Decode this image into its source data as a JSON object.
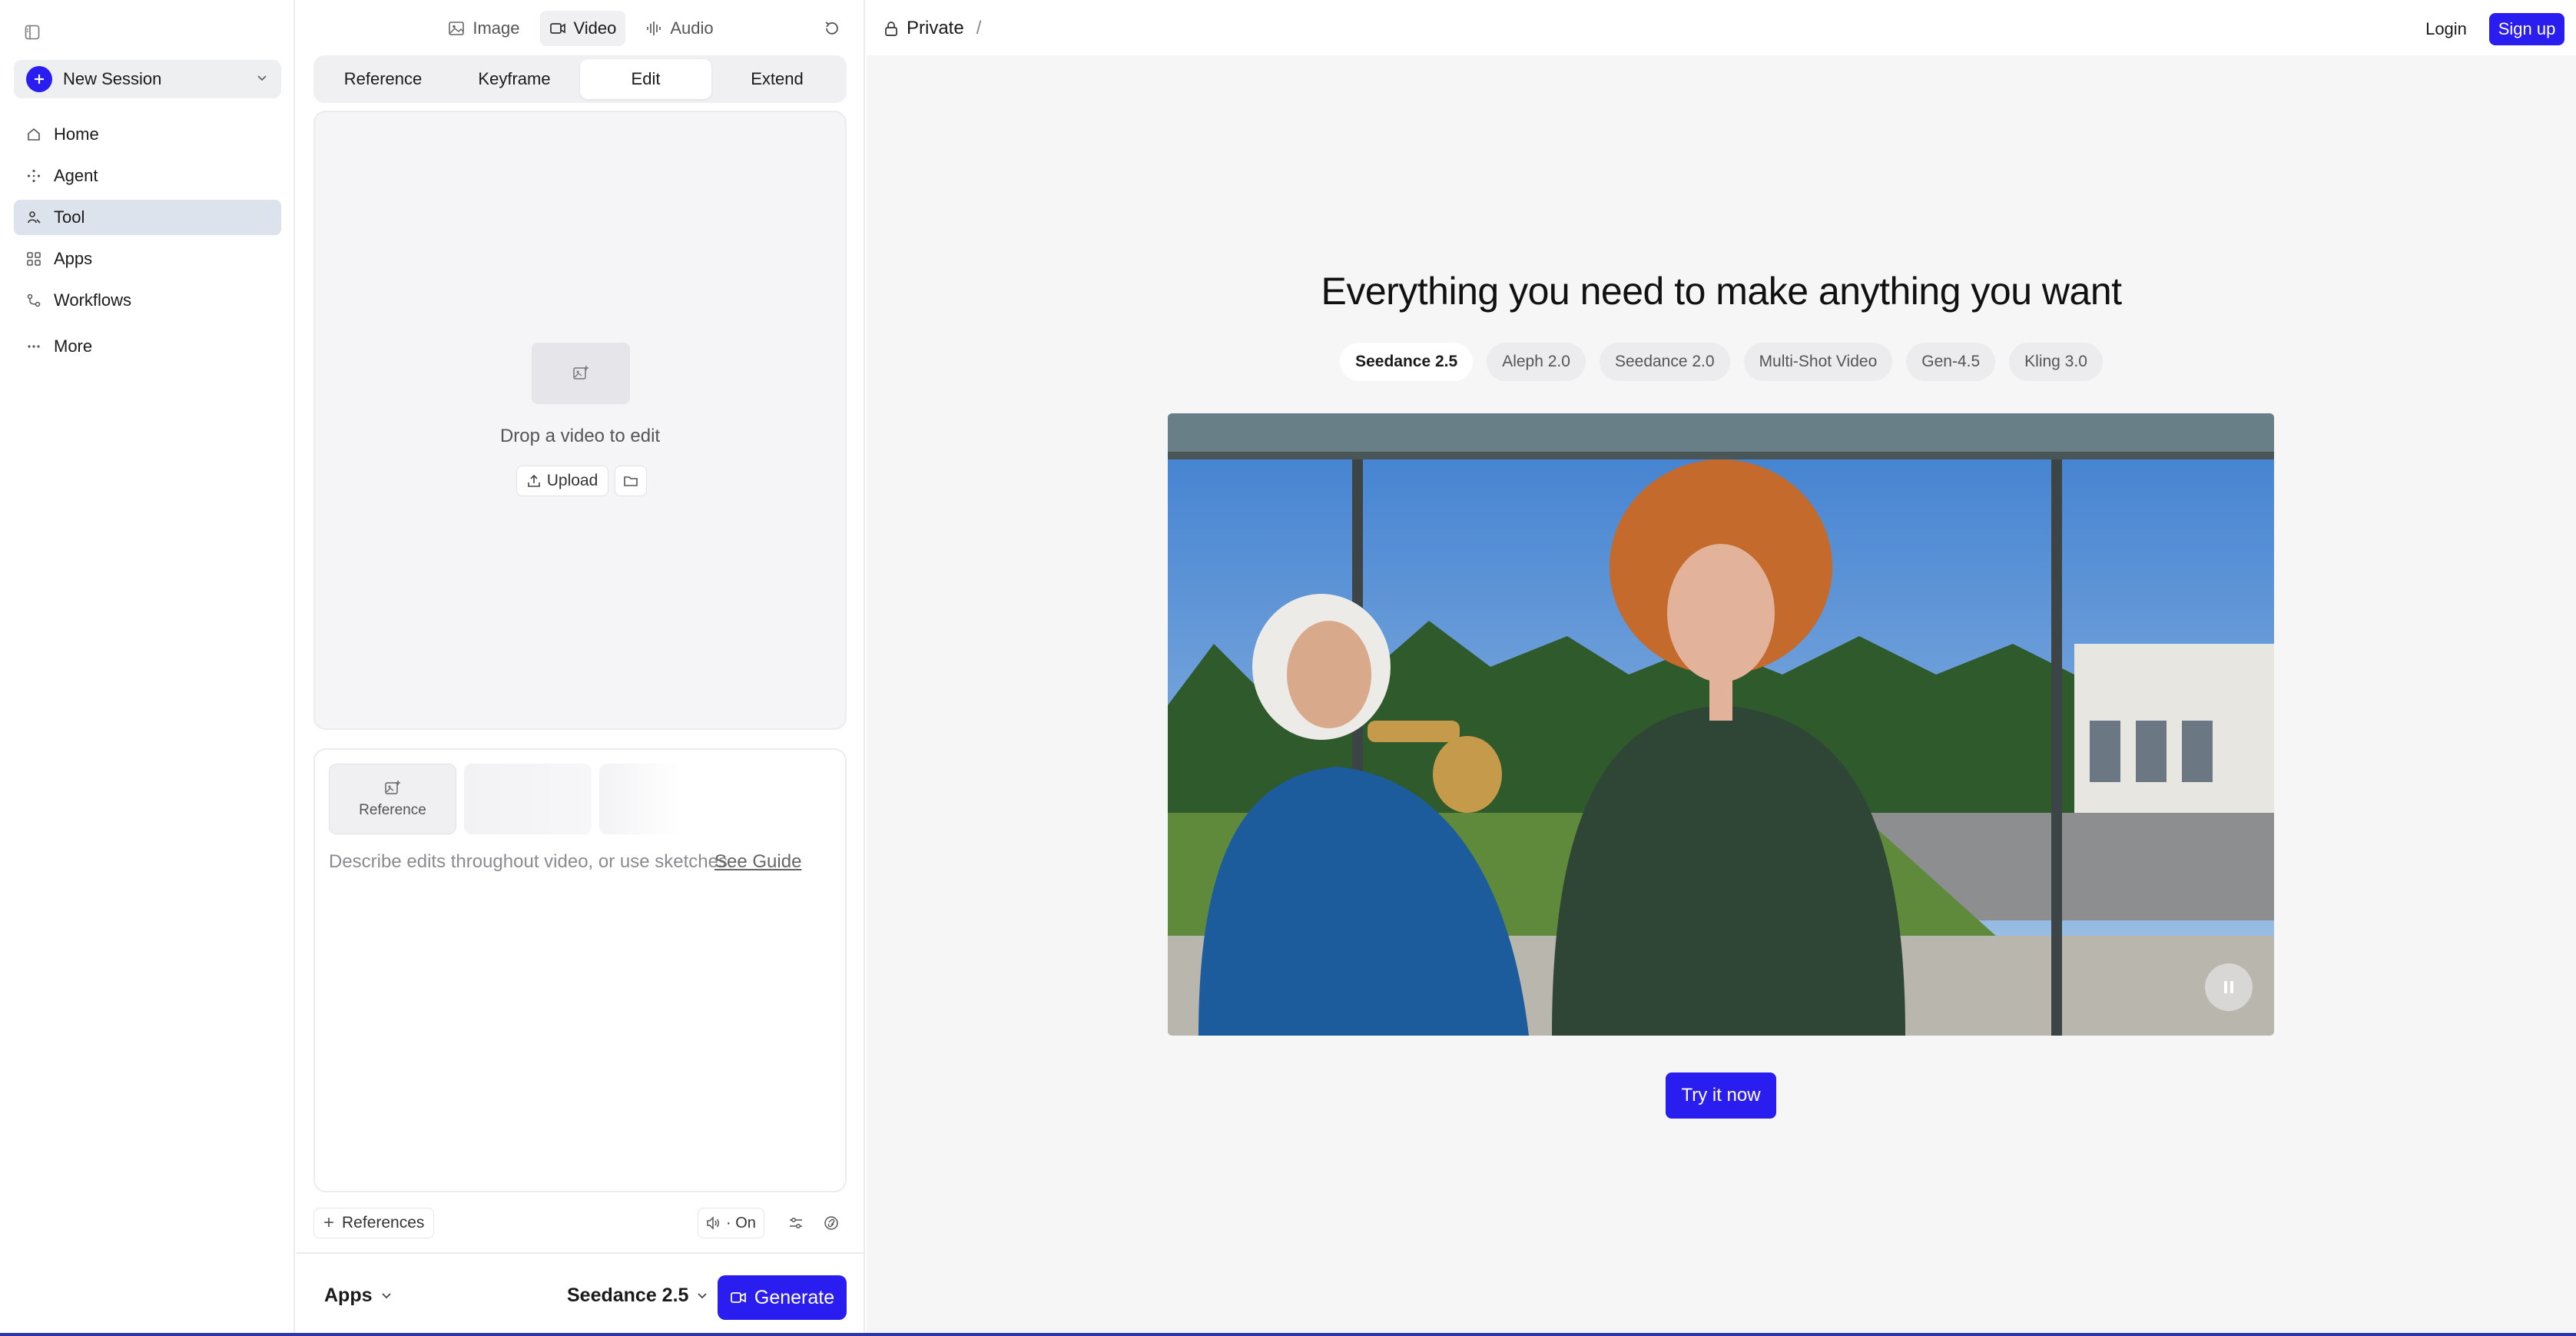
{
  "sidebar": {
    "new_session_label": "New Session",
    "items": [
      {
        "label": "Home",
        "icon": "home-icon"
      },
      {
        "label": "Agent",
        "icon": "agent-icon"
      },
      {
        "label": "Tool",
        "icon": "tool-icon",
        "active": true
      },
      {
        "label": "Apps",
        "icon": "apps-grid-icon"
      },
      {
        "label": "Workflows",
        "icon": "workflows-icon"
      },
      {
        "label": "More",
        "icon": "more-dots-icon"
      }
    ]
  },
  "tool_panel": {
    "media_tabs": [
      {
        "label": "Image",
        "icon": "image-icon"
      },
      {
        "label": "Video",
        "icon": "video-camera-icon",
        "active": true
      },
      {
        "label": "Audio",
        "icon": "audio-wave-icon"
      }
    ],
    "mode_tabs": [
      {
        "label": "Reference"
      },
      {
        "label": "Keyframe"
      },
      {
        "label": "Edit",
        "active": true
      },
      {
        "label": "Extend"
      }
    ],
    "drop_zone": {
      "text": "Drop a video to edit",
      "upload_label": "Upload"
    },
    "prompt": {
      "reference_card_label": "Reference",
      "placeholder": "Describe edits throughout video, or use sketches.",
      "guide_link": "See Guide"
    },
    "toolbar": {
      "references_label": "References",
      "audio_label": "· On"
    },
    "bottom": {
      "apps_label": "Apps",
      "model_label": "Seedance 2.5",
      "generate_label": "Generate"
    }
  },
  "main": {
    "breadcrumb": {
      "label": "Private",
      "separator": "/"
    },
    "login_label": "Login",
    "signup_label": "Sign up",
    "hero_title": "Everything you need to make anything you want",
    "model_pills": [
      {
        "label": "Seedance 2.5",
        "active": true
      },
      {
        "label": "Aleph 2.0"
      },
      {
        "label": "Seedance 2.0"
      },
      {
        "label": "Multi-Shot Video"
      },
      {
        "label": "Gen-4.5"
      },
      {
        "label": "Kling 3.0"
      }
    ],
    "try_now_label": "Try it now"
  },
  "colors": {
    "accent": "#2a1df0",
    "active_nav": "#dde3ec",
    "main_bg": "#f6f6f7"
  }
}
